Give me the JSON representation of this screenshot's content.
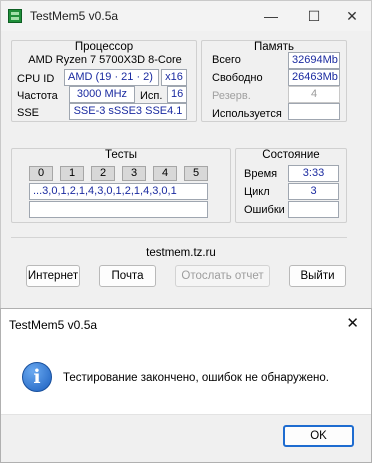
{
  "window": {
    "title": "TestMem5 v0.5a",
    "minimize": "—",
    "maximize": "☐",
    "close": "✕"
  },
  "cpu": {
    "group_title": "Процессор",
    "name": "AMD Ryzen 7 5700X3D 8-Core",
    "cpuid_label": "CPU ID",
    "cpuid_value": "AMD  (19 · 21 · 2)",
    "cpuid_mult": "x16",
    "freq_label": "Частота",
    "freq_value": "3000 MHz",
    "used_label": "Исп.",
    "used_value": "16",
    "sse_label": "SSE",
    "sse_value": "SSE-3 sSSE3 SSE4.1"
  },
  "memory": {
    "group_title": "Память",
    "total_label": "Всего",
    "total_value": "32694Mb",
    "free_label": "Свободно",
    "free_value": "26463Mb",
    "reserve_label": "Резерв.",
    "reserve_value": "4",
    "used_label": "Используется",
    "used_value": ""
  },
  "tests": {
    "group_title": "Тесты",
    "cells": [
      "0",
      "1",
      "2",
      "3",
      "4",
      "5"
    ],
    "sequence": "...3,0,1,2,1,4,3,0,1,2,1,4,3,0,1",
    "extra": ""
  },
  "status": {
    "group_title": "Состояние",
    "time_label": "Время",
    "time_value": "3:33",
    "cycle_label": "Цикл",
    "cycle_value": "3",
    "errors_label": "Ошибки",
    "errors_value": ""
  },
  "footer": {
    "site": "testmem.tz.ru",
    "internet": "Интернет",
    "mail": "Почта",
    "send_report": "Отослать отчет",
    "exit": "Выйти"
  },
  "dialog": {
    "title": "TestMem5 v0.5a",
    "close": "✕",
    "icon_glyph": "i",
    "message": "Тестирование закончено, ошибок не обнаружено.",
    "ok": "OK"
  }
}
